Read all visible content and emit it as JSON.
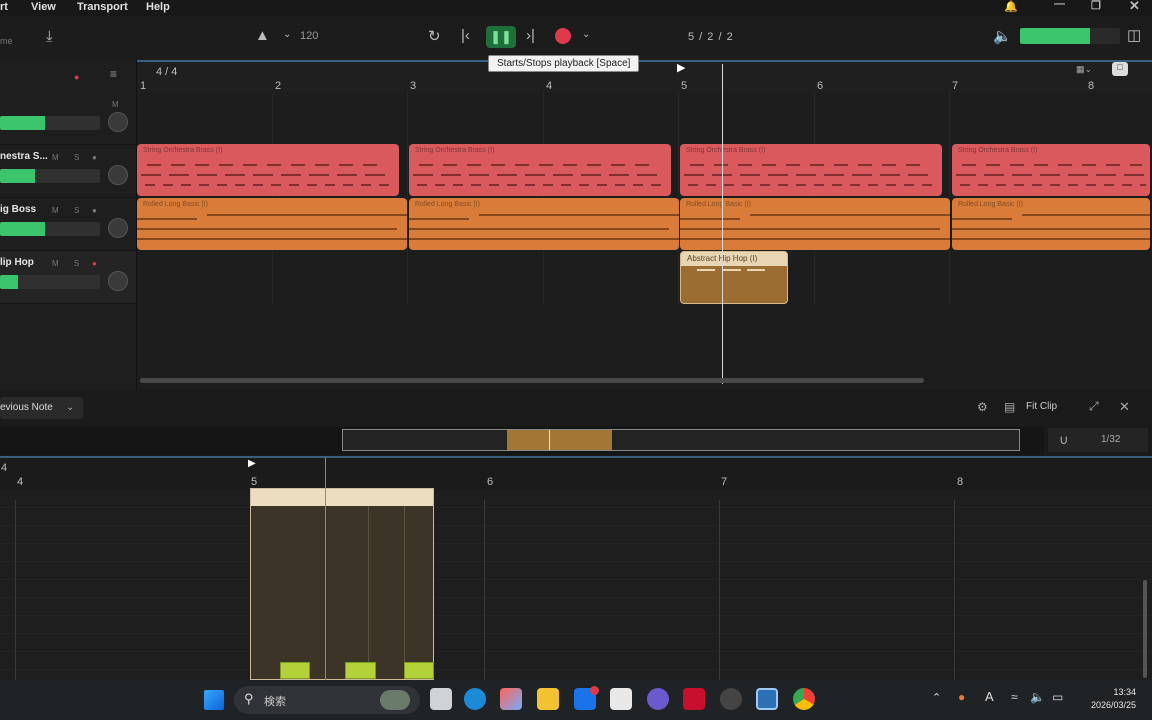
{
  "menu": {
    "items": [
      "rt",
      "View",
      "Transport",
      "Help"
    ]
  },
  "toolbar": {
    "left_label": "me",
    "tempo": "120",
    "position": "5 / 2 / 2",
    "tooltip": "Starts/Stops playback [Space]"
  },
  "master_meter_level": 0.7,
  "ruler": {
    "time_signature": "4 / 4",
    "bars": [
      "1",
      "2",
      "3",
      "4",
      "5",
      "6",
      "7",
      "8"
    ]
  },
  "tracks": [
    {
      "name": "",
      "level": 0.45
    },
    {
      "name": "nestra S...",
      "level": 0.35
    },
    {
      "name": "ig Boss",
      "level": 0.45
    },
    {
      "name": "lip Hop",
      "level": 0.18
    }
  ],
  "clips": [
    {
      "label": "String Orchestra Brass (I)"
    },
    {
      "label": "String Orchestra Brass (I)"
    },
    {
      "label": "String Orchestra Brass (I)"
    },
    {
      "label": "String Orchestra Brass (I)"
    },
    {
      "label": "Rolled Long Basic (I)"
    },
    {
      "label": "Rolled Long Basic (I)"
    },
    {
      "label": "Rolled Long Basic (I)"
    },
    {
      "label": "Rolled Long Basic (I)"
    },
    {
      "label": "Abstract Hip Hop (I)"
    }
  ],
  "editor": {
    "prev_note_label": "evious Note",
    "fit_clip_label": "Fit Clip",
    "grid_value": "1/32",
    "bars": [
      "4",
      "5",
      "6",
      "7",
      "8"
    ]
  },
  "taskbar": {
    "search_placeholder": "検索",
    "time": "13:34",
    "date": "2026/03/25"
  },
  "colors": {
    "accent_green": "#3cc46c",
    "record_red": "#e0394b",
    "clip_red": "#d9595c",
    "clip_orange": "#d97b39",
    "clip_brown": "#9b6d33",
    "note_green": "#b3d23a"
  }
}
